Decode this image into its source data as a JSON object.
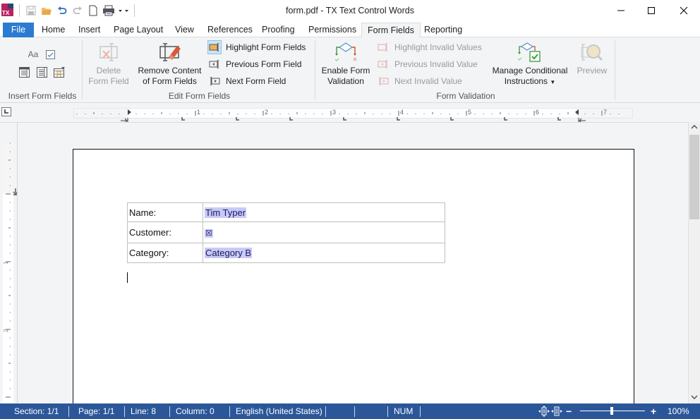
{
  "window": {
    "title": "form.pdf - TX Text Control Words",
    "logo_text": "TX",
    "controls": [
      "minimize",
      "maximize",
      "close"
    ]
  },
  "quick_access": [
    {
      "name": "save-icon",
      "enabled": false
    },
    {
      "name": "open-icon",
      "enabled": true
    },
    {
      "name": "undo-icon",
      "enabled": true
    },
    {
      "name": "redo-icon",
      "enabled": false
    },
    {
      "name": "new-document-icon",
      "enabled": true
    },
    {
      "name": "print-icon",
      "enabled": true
    },
    {
      "name": "customize-dropdown-icon",
      "enabled": true
    }
  ],
  "tabs": [
    {
      "label": "File",
      "type": "file"
    },
    {
      "label": "Home"
    },
    {
      "label": "Insert"
    },
    {
      "label": "Page Layout"
    },
    {
      "label": "View"
    },
    {
      "label": "References"
    },
    {
      "label": "Proofing"
    },
    {
      "label": "Permissions"
    },
    {
      "label": "Form Fields",
      "active": true
    },
    {
      "label": "Reporting"
    }
  ],
  "ribbon": {
    "groups": {
      "insert_form_fields": "Insert Form Fields",
      "edit_form_fields": "Edit Form Fields",
      "form_validation": "Form Validation"
    },
    "insert": {
      "text_field_icon_label": "Aa"
    },
    "delete_form_field": {
      "line1": "Delete",
      "line2": "Form Field",
      "enabled": false
    },
    "remove_content": {
      "line1": "Remove Content",
      "line2": "of Form Fields",
      "enabled": true
    },
    "highlight_form_fields": {
      "label": "Highlight Form Fields",
      "checked": true
    },
    "previous_form_field": {
      "label": "Previous Form Field"
    },
    "next_form_field": {
      "label": "Next Form Field"
    },
    "enable_validation": {
      "line1": "Enable Form",
      "line2": "Validation"
    },
    "highlight_invalid": {
      "label": "Highlight Invalid Values",
      "enabled": false
    },
    "previous_invalid": {
      "label": "Previous Invalid Value",
      "enabled": false
    },
    "next_invalid": {
      "label": "Next Invalid Value",
      "enabled": false
    },
    "manage_conditional": {
      "line1": "Manage Conditional",
      "line2": "Instructions"
    },
    "preview": {
      "label": "Preview",
      "enabled": false
    }
  },
  "ruler": {
    "h_numbers": [
      "1",
      "2",
      "3",
      "4",
      "5",
      "6",
      "7"
    ],
    "v_numbers": [
      "1",
      "2"
    ]
  },
  "document": {
    "form_rows": [
      {
        "label": "Name:",
        "value": "Tim Typer",
        "type": "text"
      },
      {
        "label": "Customer:",
        "value": "☒",
        "type": "checkbox",
        "checked": true
      },
      {
        "label": "Category:",
        "value": "Category B",
        "type": "dropdown"
      }
    ],
    "highlight_color": "#c9c9f7"
  },
  "statusbar": {
    "section": "Section: 1/1",
    "page": "Page: 1/1",
    "line": "Line: 8",
    "column": "Column: 0",
    "language": "English (United States)",
    "num": "NUM",
    "zoom": "100%",
    "zoom_minus": "−",
    "zoom_plus": "+",
    "color": "#2b579a"
  }
}
